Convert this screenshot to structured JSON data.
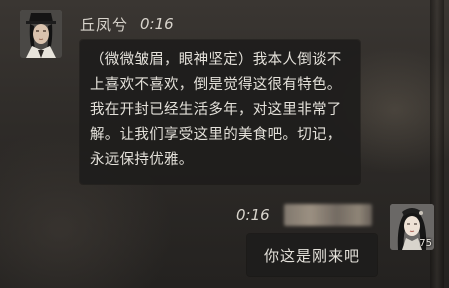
{
  "chat": {
    "messages": [
      {
        "sender": "丘凤兮",
        "time": "0:16",
        "side": "left",
        "avatar_icon": "male-scholar-avatar-icon",
        "text": "（微微皱眉，眼神坚定）我本人倒谈不上喜欢不喜欢，倒是觉得这很有特色。我在开封已经生活多年，对这里非常了解。让我们享受这里的美食吧。切记，永远保持优雅。"
      },
      {
        "sender": "",
        "time": "0:16",
        "side": "right",
        "avatar_icon": "female-player-avatar-icon",
        "avatar_level": "75",
        "text": "你这是刚来吧"
      }
    ]
  }
}
